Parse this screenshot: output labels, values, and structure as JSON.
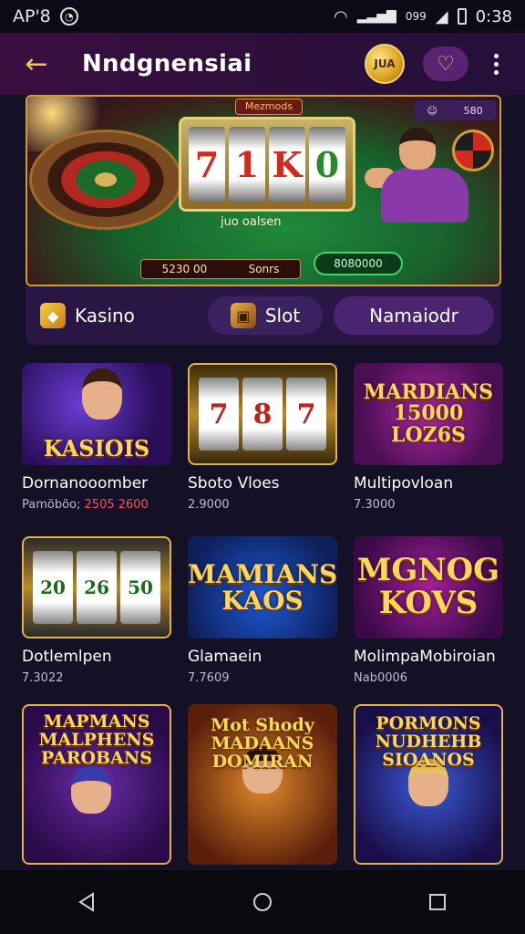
{
  "status_bar": {
    "carrier": "AP'8",
    "signal_text": "099",
    "time": "0:38"
  },
  "app_bar": {
    "title": "Nndgnensiai",
    "coin_label": "JUA"
  },
  "banner": {
    "tag": "Mezmods",
    "badge_left": "☺",
    "badge_right": "580",
    "reels": [
      "7",
      "1",
      "K",
      "0"
    ],
    "center_label": "juo oalsen",
    "score_left_a": "5230 00",
    "score_left_b": "Sonrs",
    "score_right": "8080000"
  },
  "tabs": [
    {
      "label": "Kasino",
      "icon": "cube-icon"
    },
    {
      "label": "Slot",
      "icon": "treasure-box-icon"
    },
    {
      "label": "Namaiodr"
    }
  ],
  "games": [
    {
      "name": "Dornanooomber",
      "sub_a": "Pamöböo;",
      "sub_b": "2505 2600",
      "thumb_text": "KASIOIS"
    },
    {
      "name": "Sboto Vloes",
      "sub_a": "2.9000",
      "sub_b": "",
      "thumb_reels": [
        "7",
        "8",
        "7"
      ]
    },
    {
      "name": "Multipovloan",
      "sub_a": "7.3000",
      "sub_b": "",
      "thumb_text": "MARDIANS 15000 LOZ6S"
    },
    {
      "name": "Dotlemlpen",
      "sub_a": "7.3022",
      "sub_b": "",
      "thumb_reels": [
        "20",
        "26",
        "50"
      ]
    },
    {
      "name": "Glamaein",
      "sub_a": "7.7609",
      "sub_b": "",
      "thumb_text": "MAMIANS KAOS"
    },
    {
      "name": "MolimpaMobiroian",
      "sub_a": "Nab0006",
      "sub_b": "",
      "thumb_text": "MGNOG KOVS"
    },
    {
      "name": "",
      "sub_a": "",
      "sub_b": "",
      "thumb_text": "MAPMANS MALPHENS PAROBANS"
    },
    {
      "name": "",
      "sub_a": "",
      "sub_b": "",
      "thumb_text": "Mot Shody MADAANS DOMIRAN"
    },
    {
      "name": "",
      "sub_a": "",
      "sub_b": "",
      "thumb_text": "PORMONS NUDHEHB SIOANOS"
    }
  ],
  "colors": {
    "accent_gold": "#f0c35a",
    "app_bar_bg": "#3a0f3f",
    "page_bg": "#141126",
    "hot_red": "#ff4d5e"
  }
}
